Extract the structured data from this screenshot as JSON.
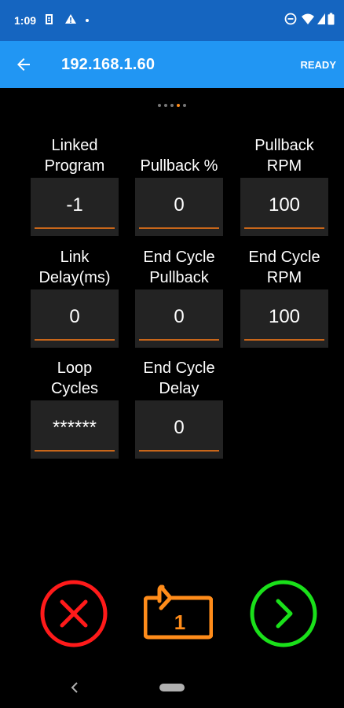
{
  "status_bar": {
    "time": "1:09"
  },
  "app_bar": {
    "title": "192.168.1.60",
    "status": "READY"
  },
  "pager": {
    "count": 5,
    "active_index": 3
  },
  "fields": [
    {
      "label": "Linked\nProgram",
      "value": "-1"
    },
    {
      "label": "Pullback %",
      "value": "0"
    },
    {
      "label": "Pullback\nRPM",
      "value": "100"
    },
    {
      "label": "Link\nDelay(ms)",
      "value": "0"
    },
    {
      "label": "End Cycle\nPullback",
      "value": "0"
    },
    {
      "label": "End Cycle\nRPM",
      "value": "100"
    },
    {
      "label": "Loop\nCycles",
      "value": "******"
    },
    {
      "label": "End Cycle\nDelay",
      "value": "0"
    }
  ],
  "actions": {
    "cancel_icon": "close-icon",
    "repeat_icon": "repeat-one-icon",
    "repeat_badge": "1",
    "next_icon": "chevron-right-icon"
  },
  "colors": {
    "status_bar": "#1565C0",
    "app_bar": "#2196F3",
    "field_bg": "#232323",
    "underline": "#C8661A",
    "cancel": "#FF1A1A",
    "repeat": "#FF8C1A",
    "next": "#1AE01A",
    "pager_active": "#FF8C1A"
  }
}
